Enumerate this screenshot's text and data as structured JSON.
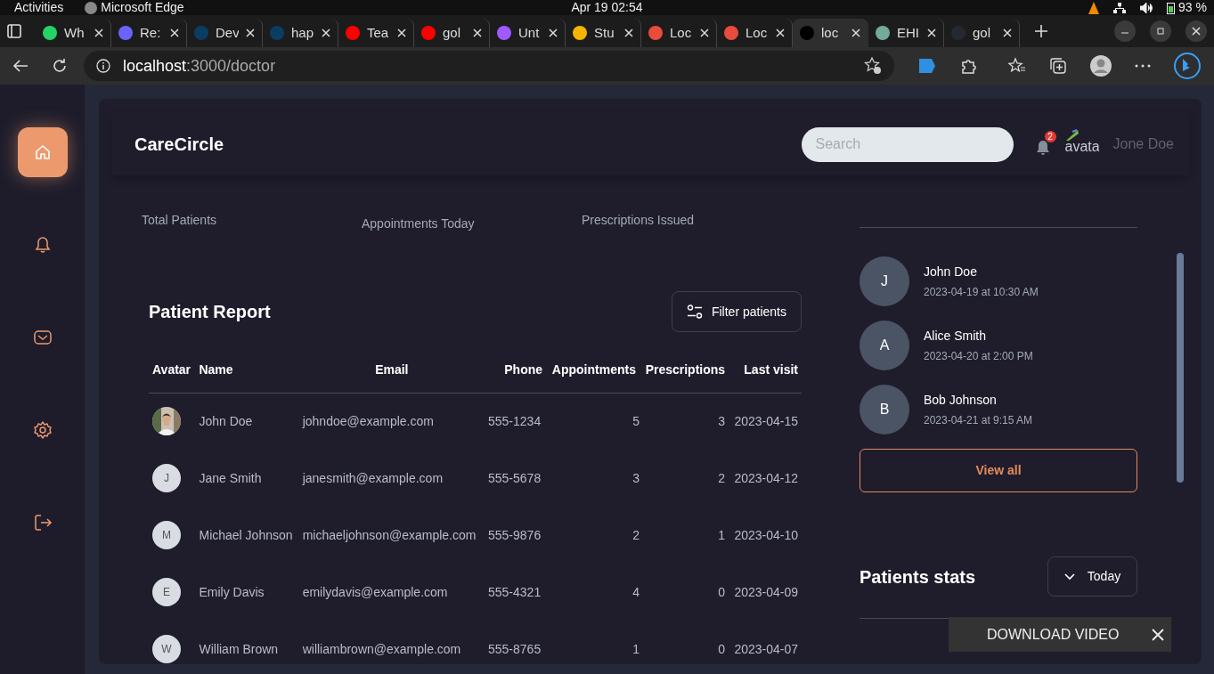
{
  "os_bar": {
    "activities": "Activities",
    "app": "Microsoft Edge",
    "clock": "Apr 19  02:54",
    "battery": "93 %"
  },
  "browser": {
    "tabs": [
      {
        "label": "Wh",
        "selected": false,
        "color": "#25d366"
      },
      {
        "label": "Re:",
        "selected": false,
        "color": "#6c63ff"
      },
      {
        "label": "Dev",
        "selected": false,
        "color": "#0a3d62"
      },
      {
        "label": "hap",
        "selected": false,
        "color": "#0a3d62"
      },
      {
        "label": "Tea",
        "selected": false,
        "color": "#ff0000"
      },
      {
        "label": "gol",
        "selected": false,
        "color": "#ff0000"
      },
      {
        "label": "Unt",
        "selected": false,
        "color": "#a259ff"
      },
      {
        "label": "Stu",
        "selected": false,
        "color": "#f4b400"
      },
      {
        "label": "Loc",
        "selected": false,
        "color": "#e94b3c"
      },
      {
        "label": "Loc",
        "selected": false,
        "color": "#e94b3c"
      },
      {
        "label": "loc",
        "selected": true,
        "color": "#000000"
      },
      {
        "label": "EHI",
        "selected": false,
        "color": "#74aa9c"
      },
      {
        "label": "gol",
        "selected": false,
        "color": "#24292f"
      }
    ],
    "url_host": "localhost",
    "url_path": ":3000/doctor"
  },
  "sidebar": {
    "items": [
      {
        "kind": "home",
        "selected": true
      },
      {
        "kind": "bell",
        "selected": false
      },
      {
        "kind": "mail",
        "selected": false
      },
      {
        "kind": "gear",
        "selected": false
      },
      {
        "kind": "logout",
        "selected": false
      }
    ]
  },
  "header": {
    "brand": "CareCircle",
    "search": {
      "placeholder": "Search"
    },
    "notification_count": "2",
    "avatar_alt": "avata",
    "user": "Jone Doe"
  },
  "stats": [
    "Total Patients",
    "Appointments Today",
    "Prescriptions Issued"
  ],
  "report": {
    "title": "Patient Report",
    "filter_button": "Filter patients",
    "columns": [
      "Avatar",
      "Name",
      "Email",
      "Phone",
      "Appointments",
      "Prescriptions",
      "Last visit"
    ],
    "rows": [
      {
        "name": "John Doe",
        "email": "johndoe@example.com",
        "phone": "555-1234",
        "appointments": "5",
        "prescriptions": "3",
        "last_visit": "2023-04-15"
      },
      {
        "avatar": {
          "kind": "initial",
          "initial": "J"
        },
        "name": "Jane Smith",
        "email": "janesmith@example.com",
        "phone": "555-5678",
        "appointments": "3",
        "prescriptions": "2",
        "last_visit": "2023-04-12"
      },
      {
        "avatar": {
          "kind": "initial",
          "initial": "M"
        },
        "name": "Michael Johnson",
        "email": "michaeljohnson@example.com",
        "phone": "555-9876",
        "appointments": "2",
        "prescriptions": "1",
        "last_visit": "2023-04-10"
      },
      {
        "avatar": {
          "kind": "initial",
          "initial": "E"
        },
        "name": "Emily Davis",
        "email": "emilydavis@example.com",
        "phone": "555-4321",
        "appointments": "4",
        "prescriptions": "0",
        "last_visit": "2023-04-09"
      },
      {
        "avatar": {
          "kind": "initial",
          "initial": "W"
        },
        "name": "William Brown",
        "email": "williambrown@example.com",
        "phone": "555-8765",
        "appointments": "1",
        "prescriptions": "0",
        "last_visit": "2023-04-07"
      }
    ]
  },
  "appointments": {
    "items": [
      {
        "initial": "J",
        "name": "John Doe",
        "time": "2023-04-19 at 10:30 AM"
      },
      {
        "initial": "A",
        "name": "Alice Smith",
        "time": "2023-04-20 at 2:00 PM"
      },
      {
        "initial": "B",
        "name": "Bob Johnson",
        "time": "2023-04-21 at 9:15 AM"
      }
    ],
    "view_all": "View all"
  },
  "patients_stats": {
    "title": "Patients stats",
    "period": "Today"
  },
  "overlay": {
    "label": "DOWNLOAD VIDEO"
  }
}
